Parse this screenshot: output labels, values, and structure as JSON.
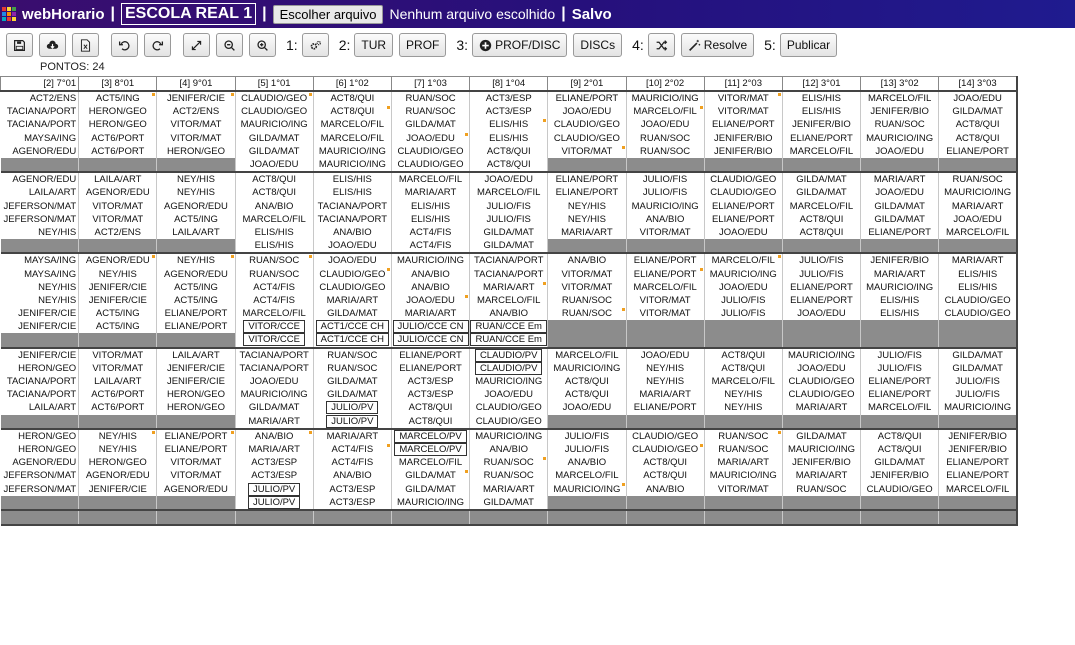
{
  "title_bar": {
    "app_name": "webHorario",
    "school_name": "ESCOLA REAL 1",
    "choose_file_button": "Escolher arquivo",
    "file_status": "Nenhum arquivo escolhido",
    "save_status": "Salvo",
    "separator": "|",
    "logo_colors": [
      "#e53935",
      "#fdd835",
      "#43a047",
      "#1e88e5",
      "#fb8c00",
      "#8e24aa",
      "#00acc1",
      "#e53935",
      "#fdd835"
    ]
  },
  "toolbar": {
    "step1": "1:",
    "step2": "2:",
    "step3": "3:",
    "step4": "4:",
    "step5": "5:",
    "tur_button": "TUR",
    "prof_button": "PROF",
    "prof_disc_button": "PROF/DISC",
    "discs_button": "DISCs",
    "resolve_button": "Resolve",
    "publish_button": "Publicar",
    "icons": [
      "save-icon",
      "cloud-download-icon",
      "excel-icon",
      "undo-icon",
      "redo-icon",
      "expand-icon",
      "zoom-out-icon",
      "zoom-in-icon",
      "gears-icon",
      "plus-circle-icon",
      "shuffle-icon",
      "magic-wand-icon"
    ]
  },
  "points": "PONTOS: 24",
  "grid": {
    "columns": [
      "[2] 7°01",
      "[3] 8°01",
      "[4] 9°01",
      "[5] 1°01",
      "[6] 1°02",
      "[7] 1°03",
      "[8] 1°04",
      "[9] 2°01",
      "[10] 2°02",
      "[11] 2°03",
      "[12] 3°01",
      "[13] 3°02",
      "[14] 3°03"
    ],
    "days": [
      {
        "rows": [
          [
            "ACT2/ENS",
            "ACT5/ING",
            "JENIFER/CIE",
            "CLAUDIO/GEO",
            "ACT8/QUI",
            "RUAN/SOC",
            "ACT3/ESP",
            "ELIANE/PORT",
            "MAURICIO/ING",
            "VITOR/MAT",
            "ELIS/HIS",
            "MARCELO/FIL",
            "JOAO/EDU"
          ],
          [
            "TACIANA/PORT",
            "HERON/GEO",
            "ACT2/ENS",
            "CLAUDIO/GEO",
            "ACT8/QUI",
            "RUAN/SOC",
            "ACT3/ESP",
            "JOAO/EDU",
            "MARCELO/FIL",
            "VITOR/MAT",
            "ELIS/HIS",
            "JENIFER/BIO",
            "GILDA/MAT"
          ],
          [
            "TACIANA/PORT",
            "HERON/GEO",
            "VITOR/MAT",
            "MAURICIO/ING",
            "MARCELO/FIL",
            "GILDA/MAT",
            "ELIS/HIS",
            "CLAUDIO/GEO",
            "JOAO/EDU",
            "ELIANE/PORT",
            "JENIFER/BIO",
            "RUAN/SOC",
            "ACT8/QUI"
          ],
          [
            "MAYSA/ING",
            "ACT6/PORT",
            "VITOR/MAT",
            "GILDA/MAT",
            "MARCELO/FIL",
            "JOAO/EDU",
            "ELIS/HIS",
            "CLAUDIO/GEO",
            "RUAN/SOC",
            "JENIFER/BIO",
            "ELIANE/PORT",
            "MAURICIO/ING",
            "ACT8/QUI"
          ],
          [
            "AGENOR/EDU",
            "ACT6/PORT",
            "HERON/GEO",
            "GILDA/MAT",
            "MAURICIO/ING",
            "CLAUDIO/GEO",
            "ACT8/QUI",
            "VITOR/MAT",
            "RUAN/SOC",
            "JENIFER/BIO",
            "MARCELO/FIL",
            "JOAO/EDU",
            "ELIANE/PORT"
          ],
          [
            "",
            "",
            "",
            "JOAO/EDU",
            "MAURICIO/ING",
            "CLAUDIO/GEO",
            "ACT8/QUI",
            "",
            "",
            "",
            "",
            "",
            ""
          ]
        ]
      },
      {
        "rows": [
          [
            "AGENOR/EDU",
            "LAILA/ART",
            "NEY/HIS",
            "ACT8/QUI",
            "ELIS/HIS",
            "MARCELO/FIL",
            "JOAO/EDU",
            "ELIANE/PORT",
            "JULIO/FIS",
            "CLAUDIO/GEO",
            "GILDA/MAT",
            "MARIA/ART",
            "RUAN/SOC"
          ],
          [
            "LAILA/ART",
            "AGENOR/EDU",
            "NEY/HIS",
            "ACT8/QUI",
            "ELIS/HIS",
            "MARIA/ART",
            "MARCELO/FIL",
            "ELIANE/PORT",
            "JULIO/FIS",
            "CLAUDIO/GEO",
            "GILDA/MAT",
            "JOAO/EDU",
            "MAURICIO/ING"
          ],
          [
            "JEFERSON/MAT",
            "VITOR/MAT",
            "AGENOR/EDU",
            "ANA/BIO",
            "TACIANA/PORT",
            "ELIS/HIS",
            "JULIO/FIS",
            "NEY/HIS",
            "MAURICIO/ING",
            "ELIANE/PORT",
            "MARCELO/FIL",
            "GILDA/MAT",
            "MARIA/ART"
          ],
          [
            "JEFERSON/MAT",
            "VITOR/MAT",
            "ACT5/ING",
            "MARCELO/FIL",
            "TACIANA/PORT",
            "ELIS/HIS",
            "JULIO/FIS",
            "NEY/HIS",
            "ANA/BIO",
            "ELIANE/PORT",
            "ACT8/QUI",
            "GILDA/MAT",
            "JOAO/EDU"
          ],
          [
            "NEY/HIS",
            "ACT2/ENS",
            "LAILA/ART",
            "ELIS/HIS",
            "ANA/BIO",
            "ACT4/FIS",
            "GILDA/MAT",
            "MARIA/ART",
            "VITOR/MAT",
            "JOAO/EDU",
            "ACT8/QUI",
            "ELIANE/PORT",
            "MARCELO/FIL"
          ],
          [
            "",
            "",
            "",
            "ELIS/HIS",
            "JOAO/EDU",
            "ACT4/FIS",
            "GILDA/MAT",
            "",
            "",
            "",
            "",
            "",
            ""
          ]
        ]
      },
      {
        "rows": [
          [
            "MAYSA/ING",
            "AGENOR/EDU",
            "NEY/HIS",
            "RUAN/SOC",
            "JOAO/EDU",
            "MAURICIO/ING",
            "TACIANA/PORT",
            "ANA/BIO",
            "ELIANE/PORT",
            "MARCELO/FIL",
            "JULIO/FIS",
            "JENIFER/BIO",
            "MARIA/ART"
          ],
          [
            "MAYSA/ING",
            "NEY/HIS",
            "AGENOR/EDU",
            "RUAN/SOC",
            "CLAUDIO/GEO",
            "ANA/BIO",
            "TACIANA/PORT",
            "VITOR/MAT",
            "ELIANE/PORT",
            "MAURICIO/ING",
            "JULIO/FIS",
            "MARIA/ART",
            "ELIS/HIS"
          ],
          [
            "NEY/HIS",
            "JENIFER/CIE",
            "ACT5/ING",
            "ACT4/FIS",
            "CLAUDIO/GEO",
            "ANA/BIO",
            "MARIA/ART",
            "VITOR/MAT",
            "MARCELO/FIL",
            "JOAO/EDU",
            "ELIANE/PORT",
            "MAURICIO/ING",
            "ELIS/HIS"
          ],
          [
            "NEY/HIS",
            "JENIFER/CIE",
            "ACT5/ING",
            "ACT4/FIS",
            "MARIA/ART",
            "JOAO/EDU",
            "MARCELO/FIL",
            "RUAN/SOC",
            "VITOR/MAT",
            "JULIO/FIS",
            "ELIANE/PORT",
            "ELIS/HIS",
            "CLAUDIO/GEO"
          ],
          [
            "JENIFER/CIE",
            "ACT5/ING",
            "ELIANE/PORT",
            "MARCELO/FIL",
            "GILDA/MAT",
            "MARIA/ART",
            "ANA/BIO",
            "RUAN/SOC",
            "VITOR/MAT",
            "JULIO/FIS",
            "JOAO/EDU",
            "ELIS/HIS",
            "CLAUDIO/GEO"
          ],
          [
            "JENIFER/CIE",
            "ACT5/ING",
            "ELIANE/PORT",
            "VITOR/CCE",
            "ACT1/CCE CH",
            "JULIO/CCE CN",
            "RUAN/CCE Em",
            "",
            "",
            "",
            "",
            "",
            ""
          ],
          [
            "",
            "",
            "",
            "VITOR/CCE",
            "ACT1/CCE CH",
            "JULIO/CCE CN",
            "RUAN/CCE Em",
            "",
            "",
            "",
            "",
            "",
            ""
          ]
        ]
      },
      {
        "rows": [
          [
            "JENIFER/CIE",
            "VITOR/MAT",
            "LAILA/ART",
            "TACIANA/PORT",
            "RUAN/SOC",
            "ELIANE/PORT",
            "CLAUDIO/PV",
            "MARCELO/FIL",
            "JOAO/EDU",
            "ACT8/QUI",
            "MAURICIO/ING",
            "JULIO/FIS",
            "GILDA/MAT"
          ],
          [
            "HERON/GEO",
            "VITOR/MAT",
            "JENIFER/CIE",
            "TACIANA/PORT",
            "RUAN/SOC",
            "ELIANE/PORT",
            "CLAUDIO/PV",
            "MAURICIO/ING",
            "NEY/HIS",
            "ACT8/QUI",
            "JOAO/EDU",
            "JULIO/FIS",
            "GILDA/MAT"
          ],
          [
            "TACIANA/PORT",
            "LAILA/ART",
            "JENIFER/CIE",
            "JOAO/EDU",
            "GILDA/MAT",
            "ACT3/ESP",
            "MAURICIO/ING",
            "ACT8/QUI",
            "NEY/HIS",
            "MARCELO/FIL",
            "CLAUDIO/GEO",
            "ELIANE/PORT",
            "JULIO/FIS"
          ],
          [
            "TACIANA/PORT",
            "ACT6/PORT",
            "HERON/GEO",
            "MAURICIO/ING",
            "GILDA/MAT",
            "ACT3/ESP",
            "JOAO/EDU",
            "ACT8/QUI",
            "MARIA/ART",
            "NEY/HIS",
            "CLAUDIO/GEO",
            "ELIANE/PORT",
            "JULIO/FIS"
          ],
          [
            "LAILA/ART",
            "ACT6/PORT",
            "HERON/GEO",
            "GILDA/MAT",
            "JULIO/PV",
            "ACT8/QUI",
            "CLAUDIO/GEO",
            "JOAO/EDU",
            "ELIANE/PORT",
            "NEY/HIS",
            "MARIA/ART",
            "MARCELO/FIL",
            "MAURICIO/ING"
          ],
          [
            "",
            "",
            "",
            "MARIA/ART",
            "JULIO/PV",
            "ACT8/QUI",
            "CLAUDIO/GEO",
            "",
            "",
            "",
            "",
            "",
            ""
          ]
        ]
      },
      {
        "rows": [
          [
            "HERON/GEO",
            "NEY/HIS",
            "ELIANE/PORT",
            "ANA/BIO",
            "MARIA/ART",
            "MARCELO/PV",
            "MAURICIO/ING",
            "JULIO/FIS",
            "CLAUDIO/GEO",
            "RUAN/SOC",
            "GILDA/MAT",
            "ACT8/QUI",
            "JENIFER/BIO"
          ],
          [
            "HERON/GEO",
            "NEY/HIS",
            "ELIANE/PORT",
            "MARIA/ART",
            "ACT4/FIS",
            "MARCELO/PV",
            "ANA/BIO",
            "JULIO/FIS",
            "CLAUDIO/GEO",
            "RUAN/SOC",
            "MAURICIO/ING",
            "ACT8/QUI",
            "JENIFER/BIO"
          ],
          [
            "AGENOR/EDU",
            "HERON/GEO",
            "VITOR/MAT",
            "ACT3/ESP",
            "ACT4/FIS",
            "MARCELO/FIL",
            "RUAN/SOC",
            "ANA/BIO",
            "ACT8/QUI",
            "MARIA/ART",
            "JENIFER/BIO",
            "GILDA/MAT",
            "ELIANE/PORT"
          ],
          [
            "JEFERSON/MAT",
            "AGENOR/EDU",
            "VITOR/MAT",
            "ACT3/ESP",
            "ANA/BIO",
            "GILDA/MAT",
            "RUAN/SOC",
            "MARCELO/FIL",
            "ACT8/QUI",
            "MAURICIO/ING",
            "MARIA/ART",
            "JENIFER/BIO",
            "ELIANE/PORT"
          ],
          [
            "JEFERSON/MAT",
            "JENIFER/CIE",
            "AGENOR/EDU",
            "JULIO/PV",
            "ACT3/ESP",
            "GILDA/MAT",
            "MARIA/ART",
            "MAURICIO/ING",
            "ANA/BIO",
            "VITOR/MAT",
            "RUAN/SOC",
            "CLAUDIO/GEO",
            "MARCELO/FIL"
          ],
          [
            "",
            "",
            "",
            "JULIO/PV",
            "ACT3/ESP",
            "MAURICIO/ING",
            "GILDA/MAT",
            "",
            "",
            "",
            "",
            "",
            ""
          ]
        ]
      }
    ]
  }
}
